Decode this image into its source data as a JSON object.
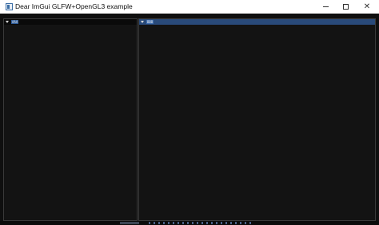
{
  "window": {
    "title": "Dear ImGui GLFW+OpenGL3 example",
    "icon": "app-icon",
    "controls": {
      "minimize": "minimize-icon",
      "maximize": "maximize-icon",
      "close": "close-icon"
    },
    "close_glyph": "✕"
  },
  "panels": [
    {
      "tab_label": "AAA",
      "arrow_icon": "collapse-arrow-icon"
    },
    {
      "tab_label": "BBB",
      "arrow_icon": "collapse-arrow-icon"
    }
  ],
  "colors": {
    "background": "#0f0f0f",
    "panel_bg": "#141414",
    "active_header": "#294a7a",
    "tab": "#2f5d9a"
  }
}
